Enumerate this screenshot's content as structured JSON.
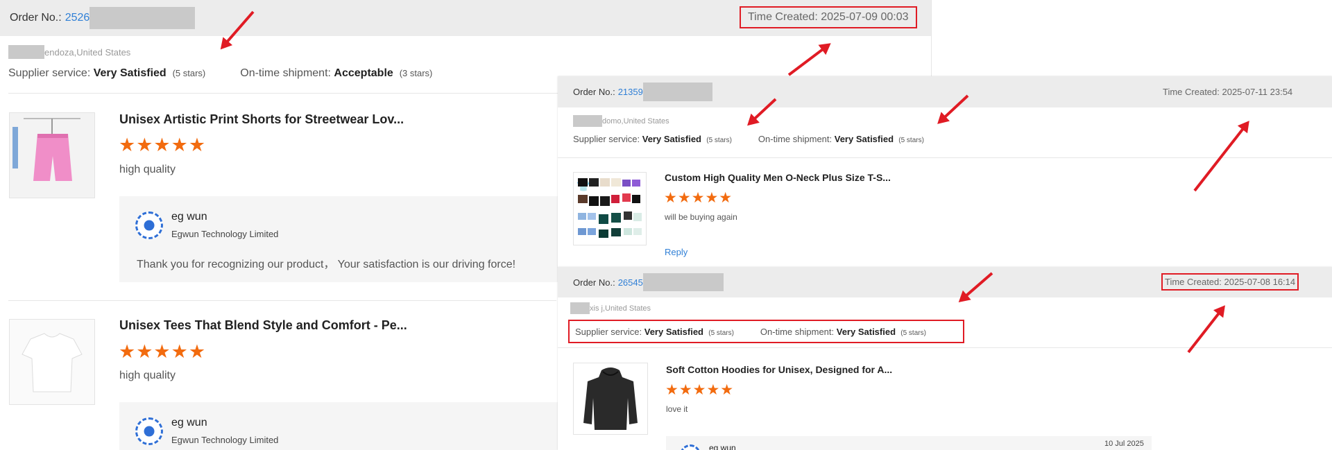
{
  "order_a": {
    "order_label": "Order No.:",
    "order_prefix": "2526",
    "time_created": "Time Created: 2025-07-09 00:03",
    "location": "endoza,United States",
    "supplier_label": "Supplier service:",
    "supplier_value": "Very Satisfied",
    "supplier_stars": "(5 stars)",
    "shipment_label": "On-time shipment:",
    "shipment_value": "Acceptable",
    "shipment_stars": "(3 stars)",
    "products": [
      {
        "title": "Unisex Artistic Print Shorts for Streetwear Lov...",
        "stars": "★★★★★",
        "review": "high quality",
        "reply_name": "eg wun",
        "reply_company": "Egwun Technology Limited",
        "reply_text": "Thank you for recognizing our product， Your satisfaction is our driving force!"
      },
      {
        "title": "Unisex Tees That Blend Style and Comfort - Pe...",
        "stars": "★★★★★",
        "review": "high quality",
        "reply_name": "eg wun",
        "reply_company": "Egwun Technology Limited"
      }
    ]
  },
  "order_b": {
    "order_label": "Order No.:",
    "order_prefix": "21359",
    "time_created": "Time Created: 2025-07-11 23:54",
    "location": "domo,United States",
    "supplier_label": "Supplier service:",
    "supplier_value": "Very Satisfied",
    "supplier_stars": "(5 stars)",
    "shipment_label": "On-time shipment:",
    "shipment_value": "Very Satisfied",
    "shipment_stars": "(5 stars)",
    "product": {
      "title": "Custom High Quality Men O-Neck Plus Size T-S...",
      "stars": "★★★★★",
      "review": "will be buying again",
      "reply_link": "Reply"
    }
  },
  "order_c": {
    "order_label": "Order No.:",
    "order_prefix": "26545",
    "time_created": "Time Created: 2025-07-08 16:14",
    "location": "xis j,United States",
    "supplier_label": "Supplier service:",
    "supplier_value": "Very Satisfied",
    "supplier_stars": "(5 stars)",
    "shipment_label": "On-time shipment:",
    "shipment_value": "Very Satisfied",
    "shipment_stars": "(5 stars)",
    "product": {
      "title": "Soft Cotton Hoodies for Unisex, Designed for A...",
      "stars": "★★★★★",
      "review": "love it",
      "reply_name": "eg wun",
      "reply_date": "10 Jul 2025"
    }
  },
  "colors": {
    "highlight": "#e01b24",
    "link": "#2f7fd6",
    "star": "#f26b0f"
  }
}
